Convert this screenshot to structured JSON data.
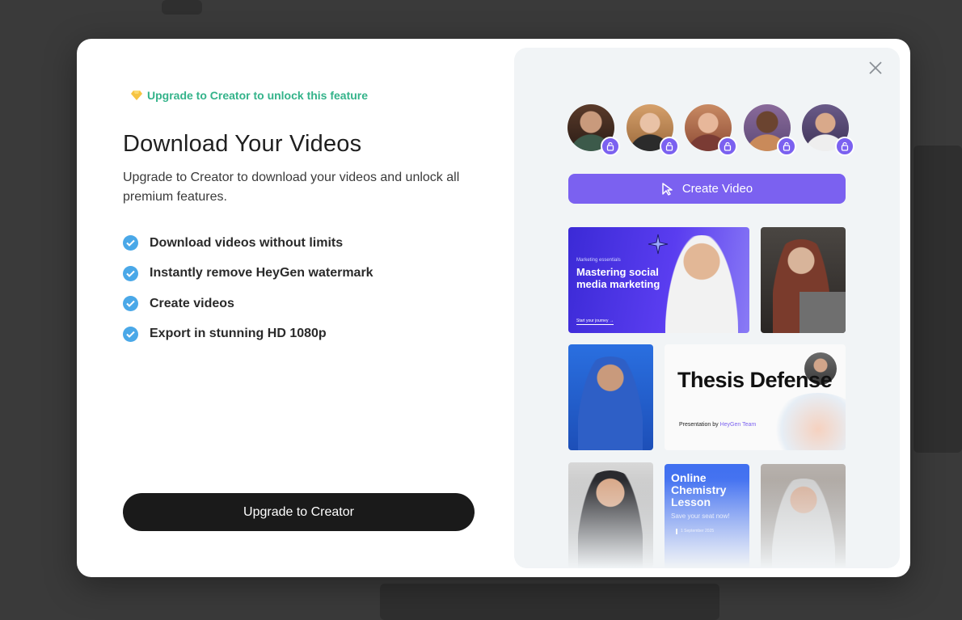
{
  "promo": {
    "text": "Upgrade to Creator to unlock this feature"
  },
  "title": "Download Your Videos",
  "subtitle": "Upgrade to Creator to download your videos and unlock all premium features.",
  "features": [
    "Download videos without limits",
    "Instantly remove HeyGen watermark",
    "Create videos",
    "Export in stunning HD 1080p"
  ],
  "upgrade_button": "Upgrade to Creator",
  "create_button": "Create Video",
  "templates": {
    "marketing": {
      "kicker": "Marketing essentials",
      "title": "Mastering social media marketing",
      "cta": "Start your journey →"
    },
    "thesis": {
      "title": "Thesis Defense",
      "by_prefix": "Presentation by ",
      "by_brand": "HeyGen Team"
    },
    "chemistry": {
      "title": "Online Chemistry Lesson",
      "sub": "Save your seat now!",
      "date": "1 September 2025"
    }
  },
  "colors": {
    "accent": "#7b61f0",
    "promo_green": "#34b38a",
    "check_blue": "#4aa8e8",
    "dark_button": "#1a1a1a"
  },
  "icons": [
    "gem-icon",
    "check-icon",
    "lock-icon",
    "cursor-icon",
    "close-icon"
  ]
}
